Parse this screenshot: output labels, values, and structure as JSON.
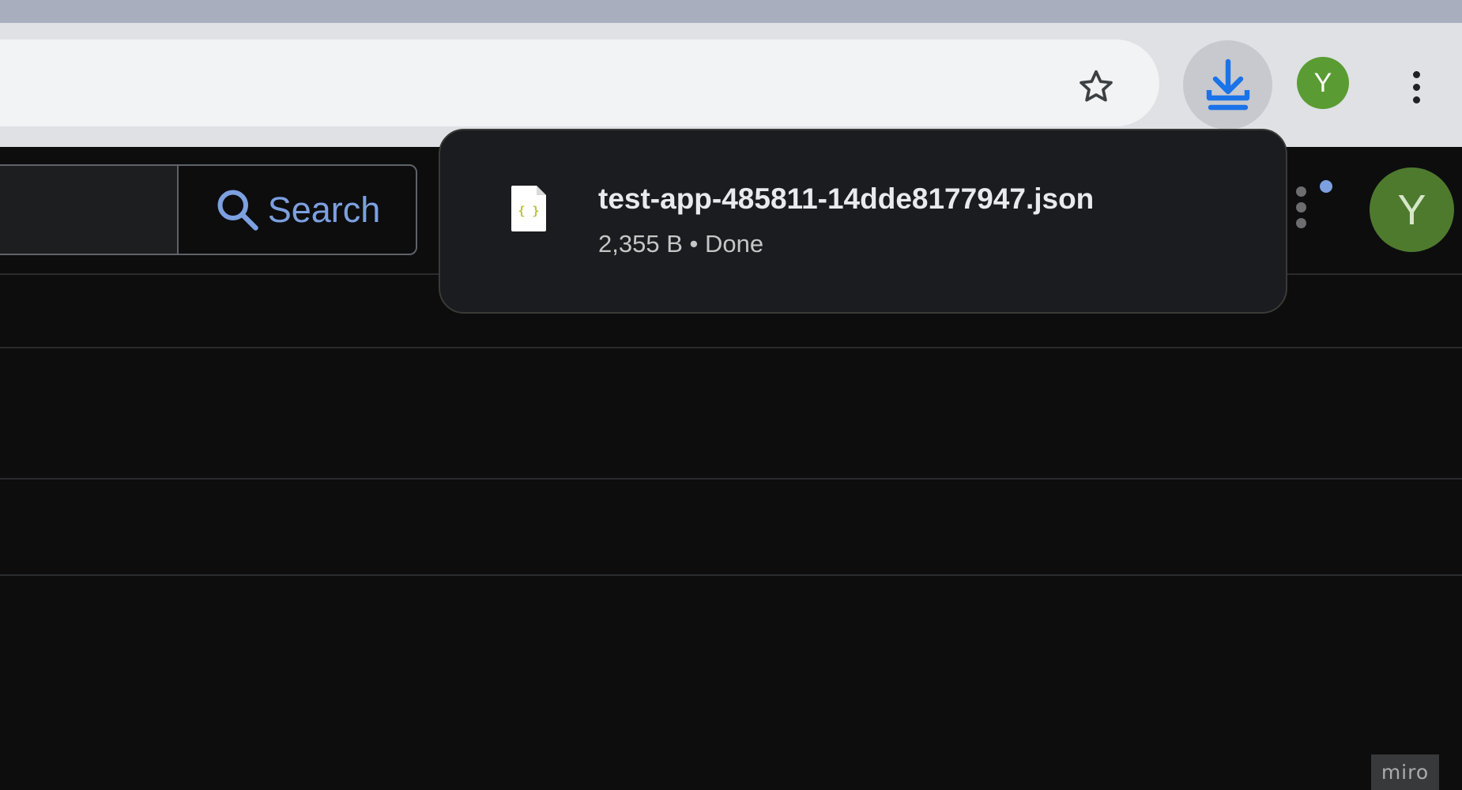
{
  "browser": {
    "profile_initial": "Y",
    "profile_color": "#5a9c33",
    "accent_color": "#1a73e8",
    "icons": {
      "bookmark": "star-outline",
      "downloads": "download-arrow",
      "menu": "vertical-dots"
    }
  },
  "page": {
    "search_label": "Search",
    "profile_initial": "Y",
    "profile_color": "#4e7a2d",
    "notification_dot_color": "#8ab4f8"
  },
  "downloads_popup": {
    "file_name": "test-app-485811-14dde8177947.json",
    "file_size": "2,355 B",
    "separator": "•",
    "status": "Done",
    "status_line": "2,355 B • Done",
    "file_icon": "json-file"
  },
  "watermark": "miro"
}
